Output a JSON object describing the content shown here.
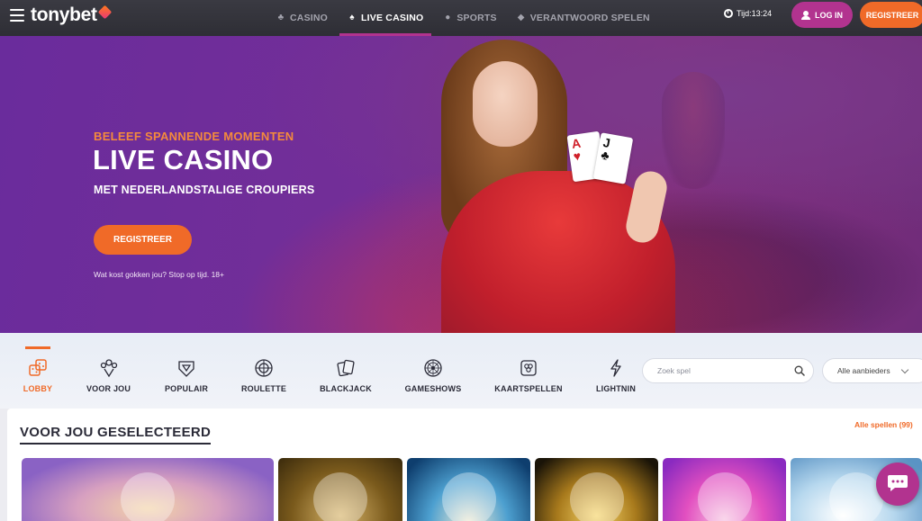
{
  "brand": {
    "name": "tonybet",
    "accent": "#f06a28",
    "secondary": "#b2338f"
  },
  "nav": {
    "links": [
      {
        "label": "CASINO",
        "icon": "casino-icon",
        "active": false
      },
      {
        "label": "LIVE CASINO",
        "icon": "live-casino-icon",
        "active": true
      },
      {
        "label": "SPORTS",
        "icon": "sports-icon",
        "active": false
      },
      {
        "label": "VERANTWOORD SPELEN",
        "icon": "shield-icon",
        "active": false
      }
    ],
    "clock": "Tijd:13:24",
    "login_label": "LOG IN",
    "register_label": "REGISTREER"
  },
  "hero": {
    "kicker": "BELEEF SPANNENDE MOMENTEN",
    "title": "LIVE CASINO",
    "subtitle": "MET NEDERLANDSTALIGE CROUPIERS",
    "cta_label": "REGISTREER",
    "disclaimer": "Wat kost gokken jou? Stop op tijd. 18+",
    "cards": [
      "A",
      "J"
    ]
  },
  "categories": [
    {
      "label": "LOBBY",
      "icon": "dice-icon",
      "active": true
    },
    {
      "label": "VOOR JOU",
      "icon": "bouquet-icon",
      "active": false
    },
    {
      "label": "POPULAIR",
      "icon": "diamond-icon",
      "active": false
    },
    {
      "label": "ROULETTE",
      "icon": "roulette-icon",
      "active": false
    },
    {
      "label": "BLACKJACK",
      "icon": "cards-icon",
      "active": false
    },
    {
      "label": "GAMESHOWS",
      "icon": "wheel-icon",
      "active": false
    },
    {
      "label": "KAARTSPELLEN",
      "icon": "card-suits-icon",
      "active": false
    },
    {
      "label": "LIGHTNIN",
      "icon": "lightning-icon",
      "active": false
    }
  ],
  "search": {
    "placeholder": "Zoek spel"
  },
  "provider_filter": {
    "selected": "Alle aanbieders"
  },
  "games_section": {
    "title": "VOOR JOU GESELECTEERD",
    "all_games_label": "Alle spellen",
    "all_games_count": "(99)"
  }
}
